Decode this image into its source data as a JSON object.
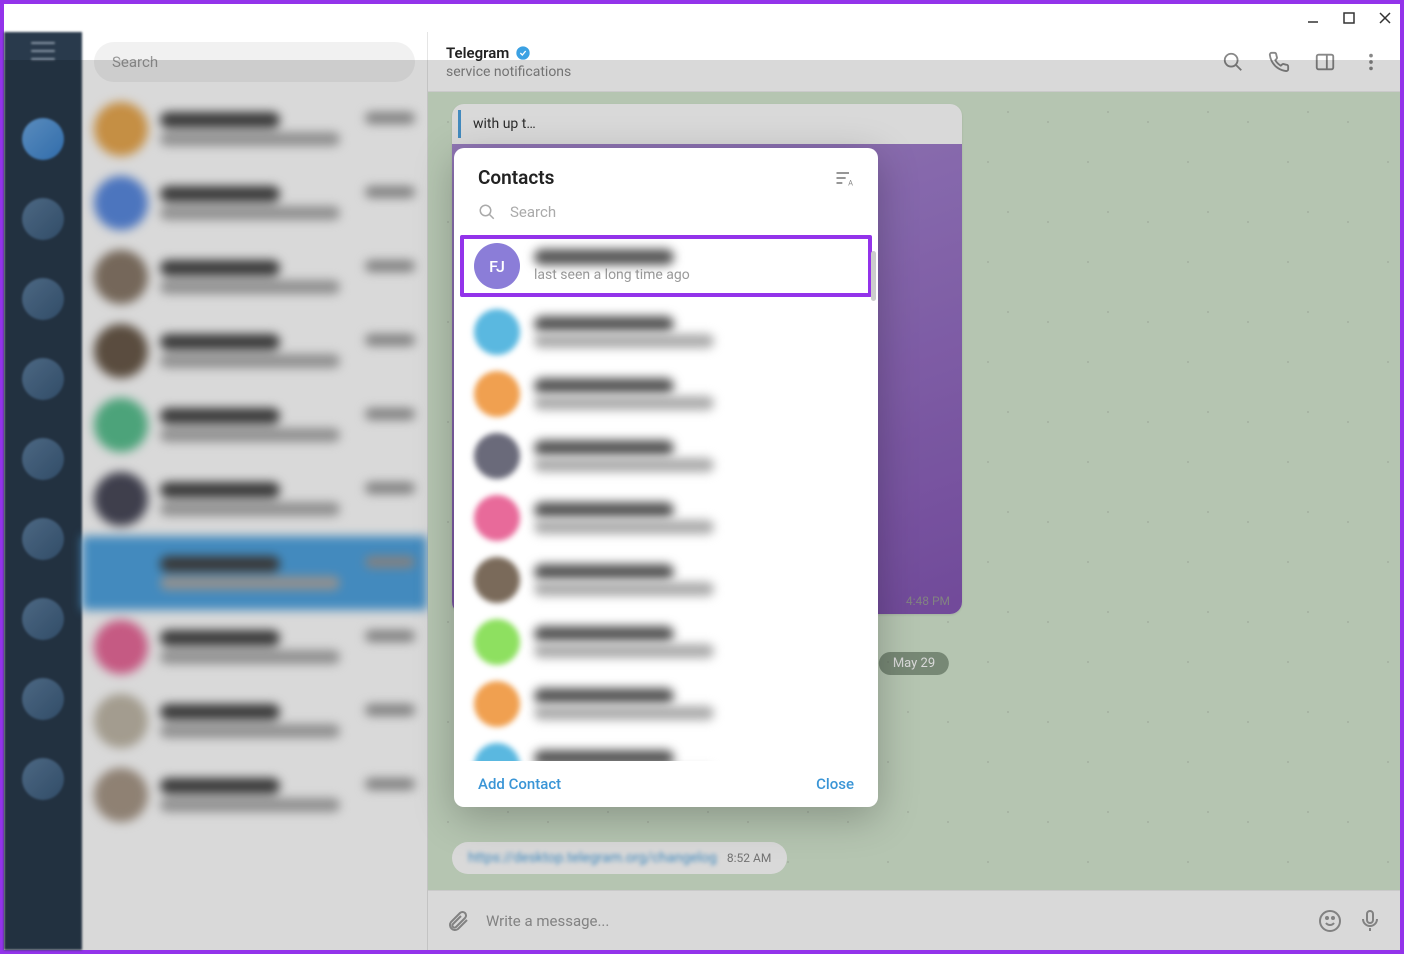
{
  "window": {
    "minimize": "–",
    "maximize": "□",
    "close": "×"
  },
  "sidebar": {
    "search_placeholder": "Search"
  },
  "chat_header": {
    "title": "Telegram",
    "subtitle": "service notifications"
  },
  "messages": {
    "card_preview": "with up t…",
    "card_time": "4:48 PM",
    "date_chip": "May 29",
    "link_text": "https://desktop.telegram.org/changelog",
    "link_time": "8:52 AM"
  },
  "composer": {
    "placeholder": "Write a message..."
  },
  "modal": {
    "title": "Contacts",
    "search_placeholder": "Search",
    "add_contact": "Add Contact",
    "close": "Close",
    "highlighted": {
      "initials": "FJ",
      "avatar_color": "#8b7dd8",
      "status": "last seen a long time ago"
    },
    "contacts": [
      {
        "color": "#5ab8e0"
      },
      {
        "color": "#f0a050"
      },
      {
        "color": "#6a6a7a"
      },
      {
        "color": "#e86a9a"
      },
      {
        "color": "#7a6a5a"
      },
      {
        "color": "#8ee060"
      },
      {
        "color": "#f0a050"
      },
      {
        "color": "#5ab8e0"
      }
    ]
  },
  "chatlist_avatars": [
    "#e8a850",
    "#5a8ae0",
    "#8a7a6a",
    "#6a5a4a",
    "#5ac090",
    "#4a4a5a",
    "#4fa3e0",
    "#e86a9a",
    "#c0b8a8",
    "#a89888"
  ]
}
